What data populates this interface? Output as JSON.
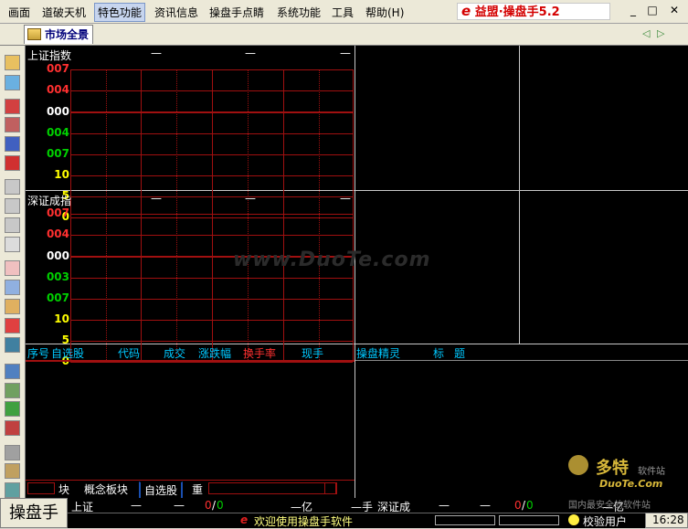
{
  "menu": {
    "items": [
      "画面",
      "道破天机",
      "特色功能",
      "资讯信息",
      "操盘手点睛",
      "系统功能",
      "工具",
      "帮助(H)"
    ],
    "active_index": 2
  },
  "brand": {
    "e": "e",
    "text": "益盟·操盘手5.2"
  },
  "window_controls": [
    "_",
    "□",
    "✕"
  ],
  "tab": {
    "label": "市场全景"
  },
  "nav": {
    "left": "◁",
    "right": "▷"
  },
  "shanghai": {
    "title": "上证指数",
    "dashes": [
      "—",
      "—",
      "—"
    ],
    "ylabels": [
      {
        "t": "007",
        "c": "#ff3030"
      },
      {
        "t": "004",
        "c": "#ff3030"
      },
      {
        "t": "000",
        "c": "#ffffff"
      },
      {
        "t": "004",
        "c": "#00d000"
      },
      {
        "t": "007",
        "c": "#00d000"
      },
      {
        "t": "10",
        "c": "#ffff00"
      },
      {
        "t": "5",
        "c": "#ffff00"
      },
      {
        "t": "0",
        "c": "#ffff00"
      }
    ]
  },
  "shenzhen": {
    "title": "深证成指",
    "dashes": [
      "—",
      "—",
      "—"
    ],
    "ylabels": [
      {
        "t": "007",
        "c": "#ff3030"
      },
      {
        "t": "004",
        "c": "#ff3030"
      },
      {
        "t": "000",
        "c": "#ffffff"
      },
      {
        "t": "003",
        "c": "#00d000"
      },
      {
        "t": "007",
        "c": "#00d000"
      },
      {
        "t": "10",
        "c": "#ffff00"
      },
      {
        "t": "5",
        "c": "#ffff00"
      },
      {
        "t": "0",
        "c": "#ffff00"
      }
    ]
  },
  "watchlist": {
    "columns": [
      "序号",
      "自选股",
      "代码",
      "成交",
      "涨跌幅",
      "换手率",
      "现手"
    ],
    "highlight_column": "换手率"
  },
  "news": {
    "columns": [
      "操盘精灵",
      "标",
      "题"
    ]
  },
  "bottom_tabs": [
    "块",
    "概念板块",
    "自选股",
    "重"
  ],
  "active_bottom_tab": "自选股",
  "status": {
    "logo": "操盘手",
    "sh_label": "上证",
    "sh_dash1": "—",
    "sh_dash2": "—",
    "sh_ratio_a": "0",
    "sh_ratio_sep": "/",
    "sh_ratio_b": "0",
    "sh_amount": "—亿",
    "sh_vol": "—手",
    "sz_label": "深证成",
    "sz_dash1": "—",
    "sz_dash2": "—",
    "sz_ratio_a": "0",
    "sz_ratio_sep": "/",
    "sz_ratio_b": "0",
    "sz_amount": "—亿",
    "welcome": "欢迎使用操盘手软件",
    "user": "校验用户",
    "time": "16:28"
  },
  "watermark": "www.DuoTe.com",
  "site_mark": {
    "name": "多特",
    "suffix": "软件站",
    "url": "DuoTe.Com",
    "slogan": "国内最安全的软件站"
  },
  "colors": {
    "grid": "#a01010",
    "up": "#ff3030",
    "down": "#00d000",
    "vol": "#ffff00",
    "header": "#00c8ff"
  }
}
